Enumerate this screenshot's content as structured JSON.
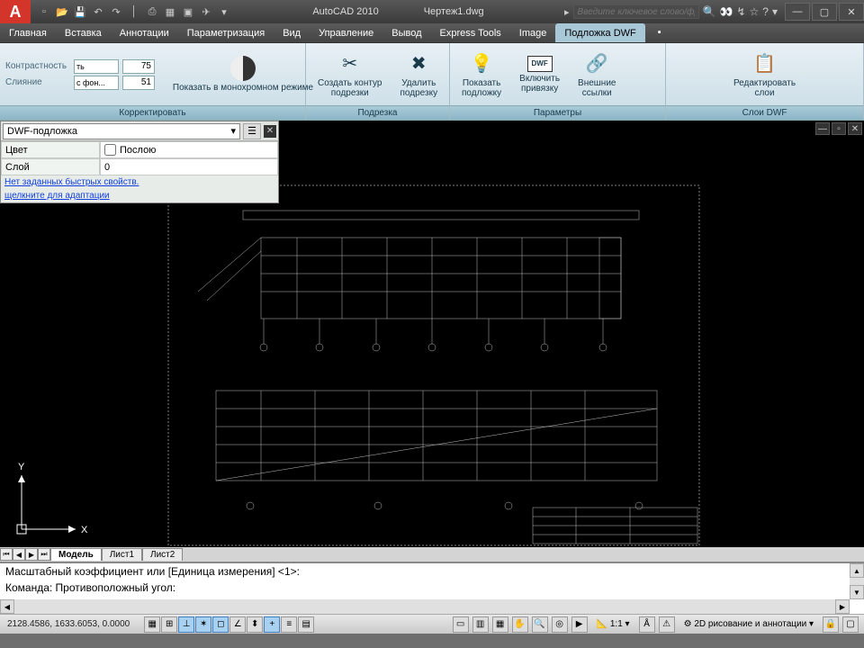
{
  "title": {
    "app": "AutoCAD 2010",
    "file": "Чертеж1.dwg"
  },
  "search": {
    "placeholder": "Введите ключевое слово/фразу"
  },
  "tabs": {
    "items": [
      "Главная",
      "Вставка",
      "Аннотации",
      "Параметризация",
      "Вид",
      "Управление",
      "Вывод",
      "Express Tools",
      "Image",
      "Подложка DWF"
    ],
    "active": 9
  },
  "ribbon": {
    "adjust": {
      "title": "Корректировать",
      "contrast_label": "Контрастность",
      "contrast_value": "75",
      "fade_label": "Слияние",
      "fade_combo": "с фон...",
      "fade_value": "51",
      "mono_label": "Показать в монохромном режиме"
    },
    "clip": {
      "title": "Подрезка",
      "create": "Создать контур\nподрезки",
      "delete": "Удалить\nподрезку"
    },
    "options": {
      "title": "Параметры",
      "show": "Показать\nподложку",
      "snap": "Включить\nпривязку",
      "xrefs": "Внешние\nссылки",
      "dwf_badge": "DWF"
    },
    "layers": {
      "title": "Слои DWF",
      "edit": "Редактировать\nслои"
    }
  },
  "props": {
    "combo": "DWF-подложка",
    "rows": [
      {
        "k": "Цвет",
        "v": "Послою",
        "checkbox": true
      },
      {
        "k": "Слой",
        "v": "0"
      }
    ],
    "link1": "Нет заданных быстрых свойств.",
    "link2": "щелкните для адаптации"
  },
  "layout": {
    "tabs": [
      "Модель",
      "Лист1",
      "Лист2"
    ],
    "active": 0
  },
  "cmd": {
    "line1": "Масштабный коэффициент или [Единица измерения] <1>:",
    "line2": "Команда: Противоположный угол:",
    "line3": "Команда:"
  },
  "status": {
    "coords": "2128.4586, 1633.6053, 0.0000",
    "scale": "1:1",
    "workspace": "2D рисование и аннотации"
  },
  "ucs": {
    "x": "X",
    "y": "Y"
  }
}
